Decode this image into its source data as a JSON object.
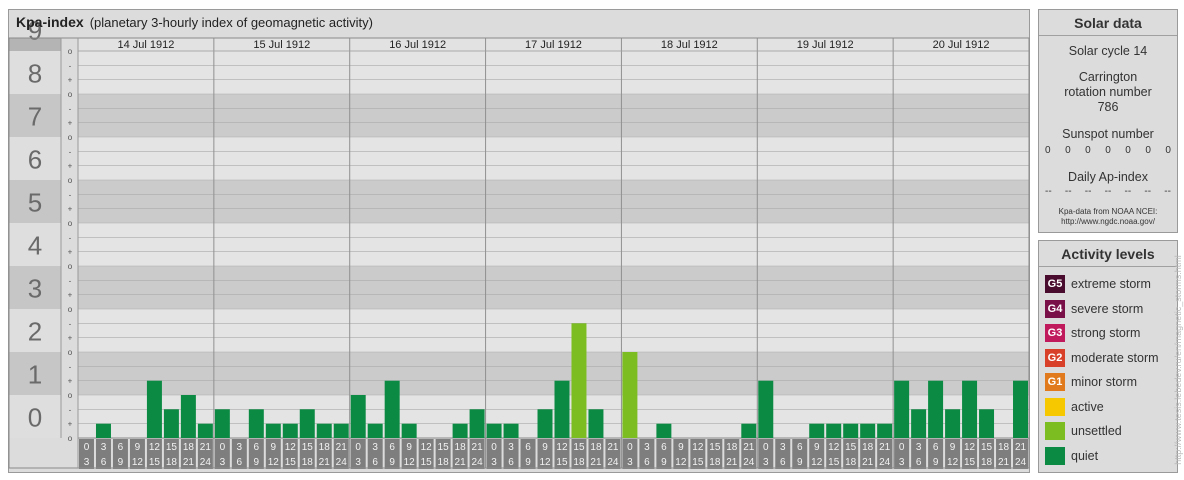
{
  "header": {
    "title": "Kpa-index",
    "subtitle": "(planetary 3-hourly index of geomagnetic activity)"
  },
  "chart_data": {
    "type": "bar",
    "title": "Kpa-index",
    "subtitle": "(planetary 3-hourly index of geomagnetic activity)",
    "ylim": [
      0,
      9
    ],
    "y_ticks": [
      "0",
      "1",
      "2",
      "3",
      "4",
      "5",
      "6",
      "7",
      "8",
      "9"
    ],
    "minor_marks": [
      "o",
      "+",
      "-"
    ],
    "days": [
      "14 Jul 1912",
      "15 Jul 1912",
      "16 Jul 1912",
      "17 Jul 1912",
      "18 Jul 1912",
      "19 Jul 1912",
      "20 Jul 1912"
    ],
    "interval_start": [
      "0",
      "3",
      "6",
      "9",
      "12",
      "15",
      "18",
      "21"
    ],
    "interval_end": [
      "3",
      "6",
      "9",
      "12",
      "15",
      "18",
      "21",
      "24"
    ],
    "values": [
      [
        0.0,
        0.333,
        0.0,
        0.0,
        1.333,
        0.667,
        1.0,
        0.333
      ],
      [
        0.667,
        0.0,
        0.667,
        0.333,
        0.333,
        0.667,
        0.333,
        0.333
      ],
      [
        1.0,
        0.333,
        1.333,
        0.333,
        0.0,
        0.0,
        0.333,
        0.667
      ],
      [
        0.333,
        0.333,
        0.0,
        0.667,
        1.333,
        2.667,
        0.667,
        0.0
      ],
      [
        2.0,
        0.0,
        0.333,
        0.0,
        0.0,
        0.0,
        0.0,
        0.333
      ],
      [
        1.333,
        0.0,
        0.0,
        0.333,
        0.333,
        0.333,
        0.333,
        0.333
      ],
      [
        1.333,
        0.667,
        1.333,
        0.667,
        1.333,
        0.667,
        0.0,
        1.333
      ]
    ],
    "colors": {
      "quiet": "#0a8a42",
      "unsettled": "#7cbd22",
      "active": "#f5c800"
    }
  },
  "solar": {
    "heading": "Solar data",
    "cycle": "Solar cycle 14",
    "carrington": "Carrington rotation number 786",
    "sunspot_label": "Sunspot number",
    "sunspots": [
      "0",
      "0",
      "0",
      "0",
      "0",
      "0",
      "0"
    ],
    "ap_label": "Daily Ap-index",
    "ap": [
      "--",
      "--",
      "--",
      "--",
      "--",
      "--",
      "--"
    ],
    "source_line1": "Kpa-data from NOAA NCEI:",
    "source_line2": "http://www.ngdc.noaa.gov/"
  },
  "activity": {
    "heading": "Activity levels",
    "levels": [
      {
        "code": "G5",
        "label": "extreme storm",
        "color": "#4a0c2e"
      },
      {
        "code": "G4",
        "label": "severe storm",
        "color": "#7a1048"
      },
      {
        "code": "G3",
        "label": "strong storm",
        "color": "#c01a5c"
      },
      {
        "code": "G2",
        "label": "moderate storm",
        "color": "#d8402a"
      },
      {
        "code": "G1",
        "label": "minor storm",
        "color": "#e07a1c"
      },
      {
        "code": "",
        "label": "active",
        "color": "#f5c800"
      },
      {
        "code": "",
        "label": "unsettled",
        "color": "#7cbd22"
      },
      {
        "code": "",
        "label": "quiet",
        "color": "#0a8a42"
      }
    ]
  },
  "watermark": "http://www.tesis.lebedev.ru/en/magnetic_storms.html"
}
